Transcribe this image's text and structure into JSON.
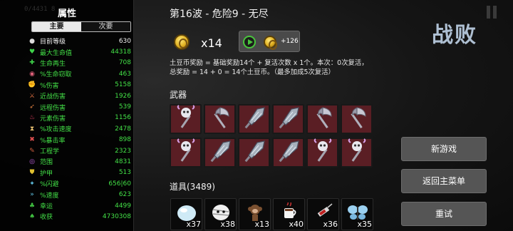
{
  "stats_panel": {
    "ghost_text": "0/4431 8",
    "title": "属性",
    "tabs": [
      {
        "label": "主要",
        "active": true
      },
      {
        "label": "次要",
        "active": false
      }
    ],
    "rows": [
      {
        "icon": "level-icon",
        "label": "目前等级",
        "value": "630",
        "color": "white"
      },
      {
        "icon": "heart-icon",
        "label": "最大生命值",
        "value": "44318",
        "color": "green"
      },
      {
        "icon": "regen-icon",
        "label": "生命再生",
        "value": "708",
        "color": "green"
      },
      {
        "icon": "lifesteal-icon",
        "label": "%生命窃取",
        "value": "463",
        "color": "green"
      },
      {
        "icon": "damage-icon",
        "label": "%伤害",
        "value": "5158",
        "color": "green"
      },
      {
        "icon": "melee-icon",
        "label": "近战伤害",
        "value": "1926",
        "color": "green"
      },
      {
        "icon": "ranged-icon",
        "label": "远程伤害",
        "value": "539",
        "color": "green"
      },
      {
        "icon": "elemental-icon",
        "label": "元素伤害",
        "value": "1156",
        "color": "green"
      },
      {
        "icon": "hourglass-icon",
        "label": "%攻击速度",
        "value": "2478",
        "color": "green"
      },
      {
        "icon": "crit-icon",
        "label": "%暴击率",
        "value": "898",
        "color": "green"
      },
      {
        "icon": "wrench-icon",
        "label": "工程学",
        "value": "2323",
        "color": "green"
      },
      {
        "icon": "range-icon",
        "label": "范围",
        "value": "4831",
        "color": "green"
      },
      {
        "icon": "shield-icon",
        "label": "护甲",
        "value": "513",
        "color": "green"
      },
      {
        "icon": "dodge-icon",
        "label": "%闪避",
        "value": "656|60",
        "color": "green"
      },
      {
        "icon": "speed-icon",
        "label": "%速度",
        "value": "623",
        "color": "green"
      },
      {
        "icon": "luck-icon",
        "label": "幸运",
        "value": "4499",
        "color": "green"
      },
      {
        "icon": "harvest-icon",
        "label": "收获",
        "value": "4730308",
        "color": "green"
      }
    ]
  },
  "main": {
    "wave_title": "第16波 - 危险9 - 无尽",
    "coin_count": "x14",
    "ad_bonus": "+126",
    "description_line1": "土豆币奖励 = 基础奖励14个 + 复活次数 x 1个。本次：0次复活，",
    "description_line2": "总奖励 = 14 + 0 = 14个土豆币。（最多加成5次复活）",
    "weapons_title": "武器",
    "weapons": [
      {
        "type": "skull-hammer-icon"
      },
      {
        "type": "axe-icon"
      },
      {
        "type": "crystal-icon"
      },
      {
        "type": "crystal-icon"
      },
      {
        "type": "axe-icon"
      },
      {
        "type": "axe-icon"
      },
      {
        "type": "skull-hammer-icon"
      },
      {
        "type": "crystal-icon"
      },
      {
        "type": "crystal-icon"
      },
      {
        "type": "crystal-icon"
      },
      {
        "type": "skull-hammer-icon"
      },
      {
        "type": "skull-hammer-icon"
      }
    ],
    "items_title": "道具(3489)",
    "items": [
      {
        "icon": "snowball-icon",
        "count": "x37"
      },
      {
        "icon": "mummy-icon",
        "count": "x38"
      },
      {
        "icon": "monkey-icon",
        "count": "x13"
      },
      {
        "icon": "coffee-icon",
        "count": "x40"
      },
      {
        "icon": "syringe-icon",
        "count": "x36"
      },
      {
        "icon": "butterfly-icon",
        "count": "x35"
      }
    ]
  },
  "right": {
    "defeat_label": "战败",
    "buttons": {
      "new_game": "新游戏",
      "main_menu": "返回主菜单",
      "retry": "重试"
    }
  },
  "colors": {
    "stat_green": "#43e047",
    "weapon_slot": "#5a1e24",
    "defeat_text": "#aebfd2",
    "ad_play": "#49c43c"
  }
}
